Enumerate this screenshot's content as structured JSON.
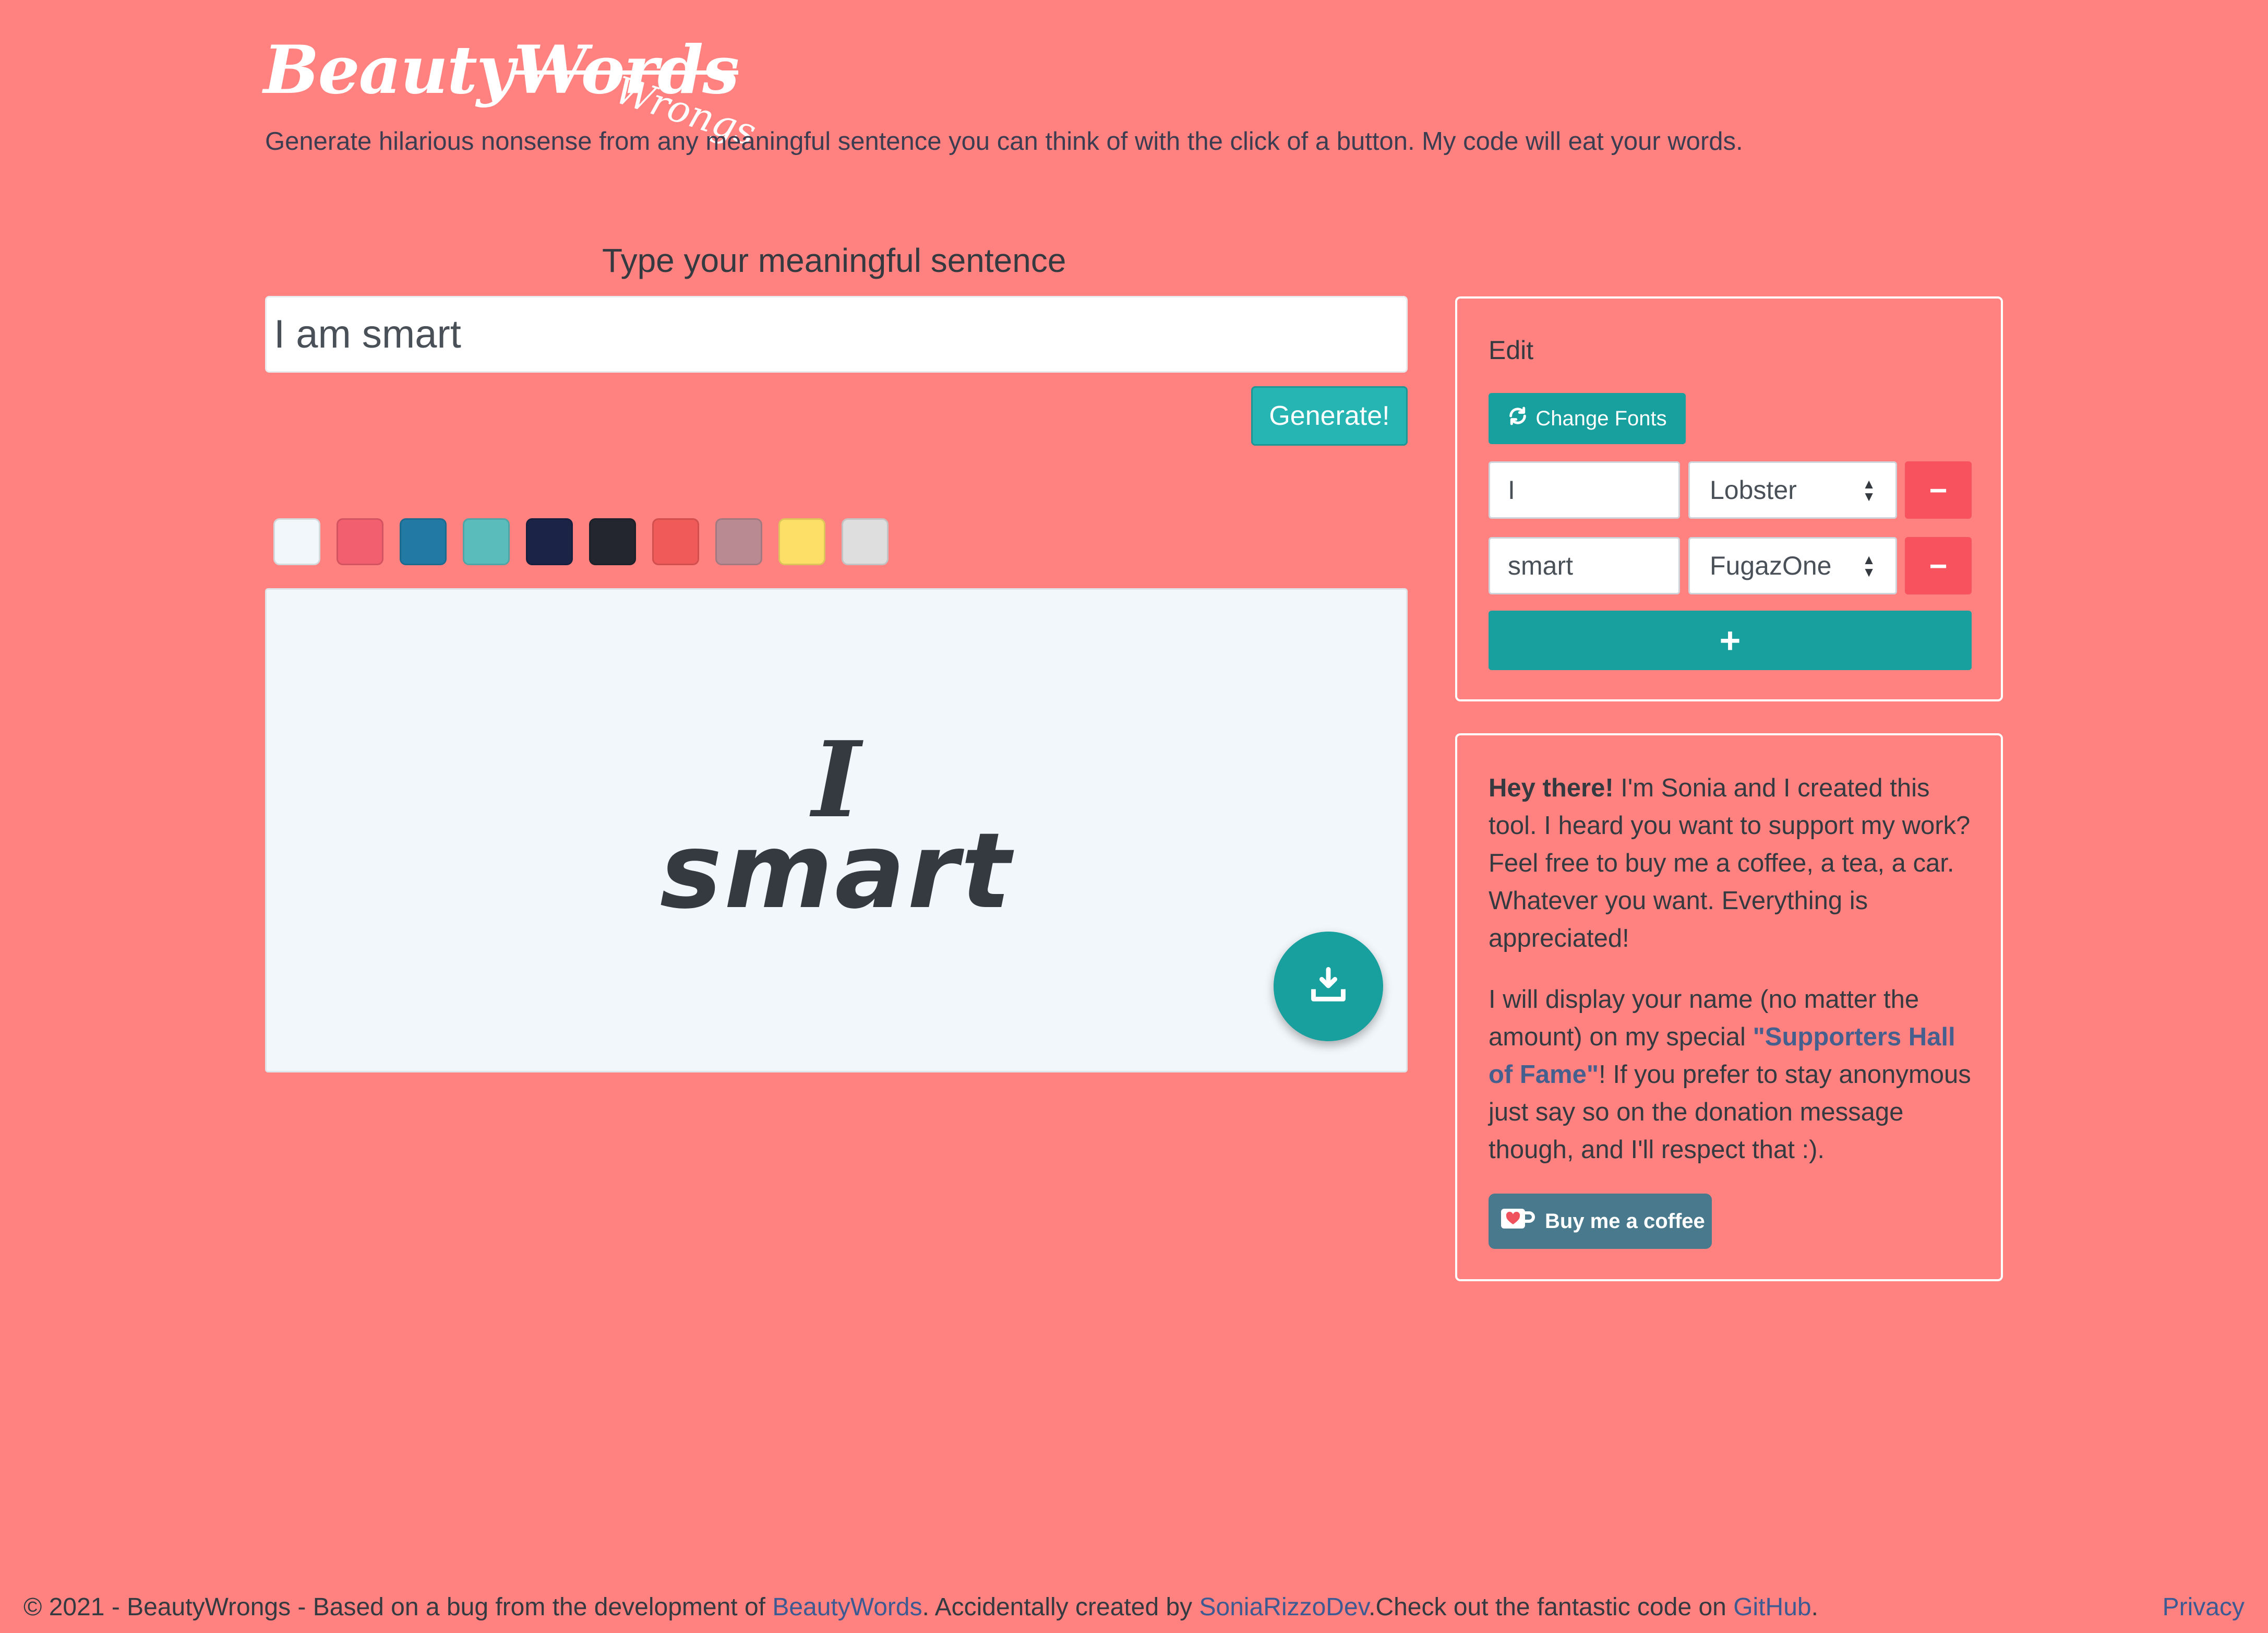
{
  "header": {
    "logo_beauty": "Beauty",
    "logo_words": "Words",
    "logo_wrongs": "Wrongs",
    "tagline": "Generate hilarious nonsense from any meaningful sentence you can think of with the click of a button. My code will eat your words."
  },
  "form": {
    "label": "Type your meaningful sentence",
    "sentence_value": "I am smart",
    "generate_label": "Generate!"
  },
  "swatches": [
    "#f2f7fb",
    "#f25f6e",
    "#2279a3",
    "#5bbcbc",
    "#1b2347",
    "#23262f",
    "#f05a59",
    "#b98a92",
    "#fddf67",
    "#dedede"
  ],
  "preview": {
    "words": [
      "I",
      "smart"
    ],
    "background": "#f2f7fb",
    "text_color": "#343a40",
    "download_icon": "download-icon"
  },
  "edit": {
    "title": "Edit",
    "change_fonts_label": "Change Fonts",
    "change_fonts_icon": "refresh-icon",
    "rows": [
      {
        "word": "I",
        "font": "Lobster",
        "remove_label": "−"
      },
      {
        "word": "smart",
        "font": "FugazOne",
        "remove_label": "−"
      }
    ],
    "add_label": "+"
  },
  "about": {
    "greeting": "Hey there!",
    "intro": " I'm Sonia and I created this tool. I heard you want to support my work? Feel free to buy me a coffee, a tea, a car. Whatever you want. Everything is appreciated!",
    "p2_start": "I will display your name (no matter the amount) on my special ",
    "p2_highlight": "\"Supporters Hall of Fame\"",
    "p2_end": "! If you prefer to stay anonymous just say so on the donation message though, and I'll respect that :).",
    "coffee_label": "Buy me a coffee"
  },
  "footer": {
    "text1": "© 2021 - BeautyWrongs - Based on a bug from the development of ",
    "link1": "BeautyWords",
    "text2": ". Accidentally created by ",
    "link2": "SoniaRizzoDev",
    "text3": ".Check out the fantastic code on ",
    "link3": "GitHub",
    "text4": ".",
    "privacy": "Privacy"
  },
  "colors": {
    "page_background": "#ff8280",
    "accent_teal": "#17a09e",
    "danger": "#f8525f",
    "link": "#3d5a92"
  }
}
